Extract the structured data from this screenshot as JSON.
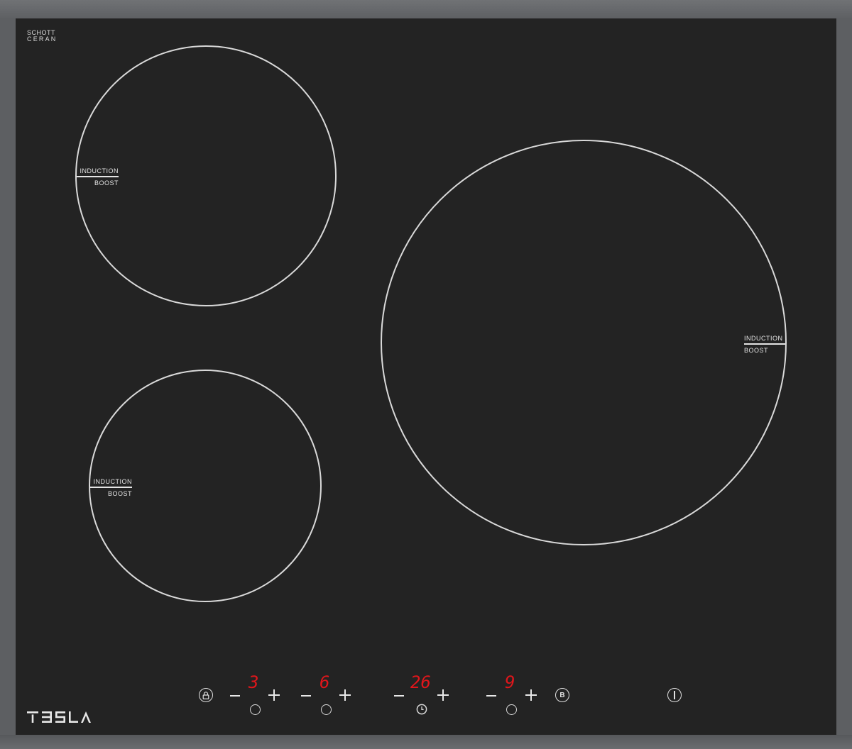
{
  "brand": {
    "schott_line1": "SCHOTT",
    "schott_line2": "CERAN",
    "tesla_logo": "TESLA"
  },
  "zones": [
    {
      "id": "rear-left",
      "label_top": "INDUCTION",
      "label_bottom": "BOOST"
    },
    {
      "id": "front-left",
      "label_top": "INDUCTION",
      "label_bottom": "BOOST"
    },
    {
      "id": "right-large",
      "label_top": "INDUCTION",
      "label_bottom": "BOOST"
    }
  ],
  "controls": {
    "display_1": "3",
    "display_2": "6",
    "display_timer": "26",
    "display_4": "9",
    "boost_label": "B",
    "icons": [
      "lock-icon",
      "minus-icon",
      "plus-icon",
      "zone-select-icon",
      "timer-icon",
      "boost-icon",
      "power-icon"
    ]
  },
  "colors": {
    "glass": "#232323",
    "frame": "#5d5f62",
    "display_red": "#e0161b",
    "marking": "#d9d9d9"
  }
}
